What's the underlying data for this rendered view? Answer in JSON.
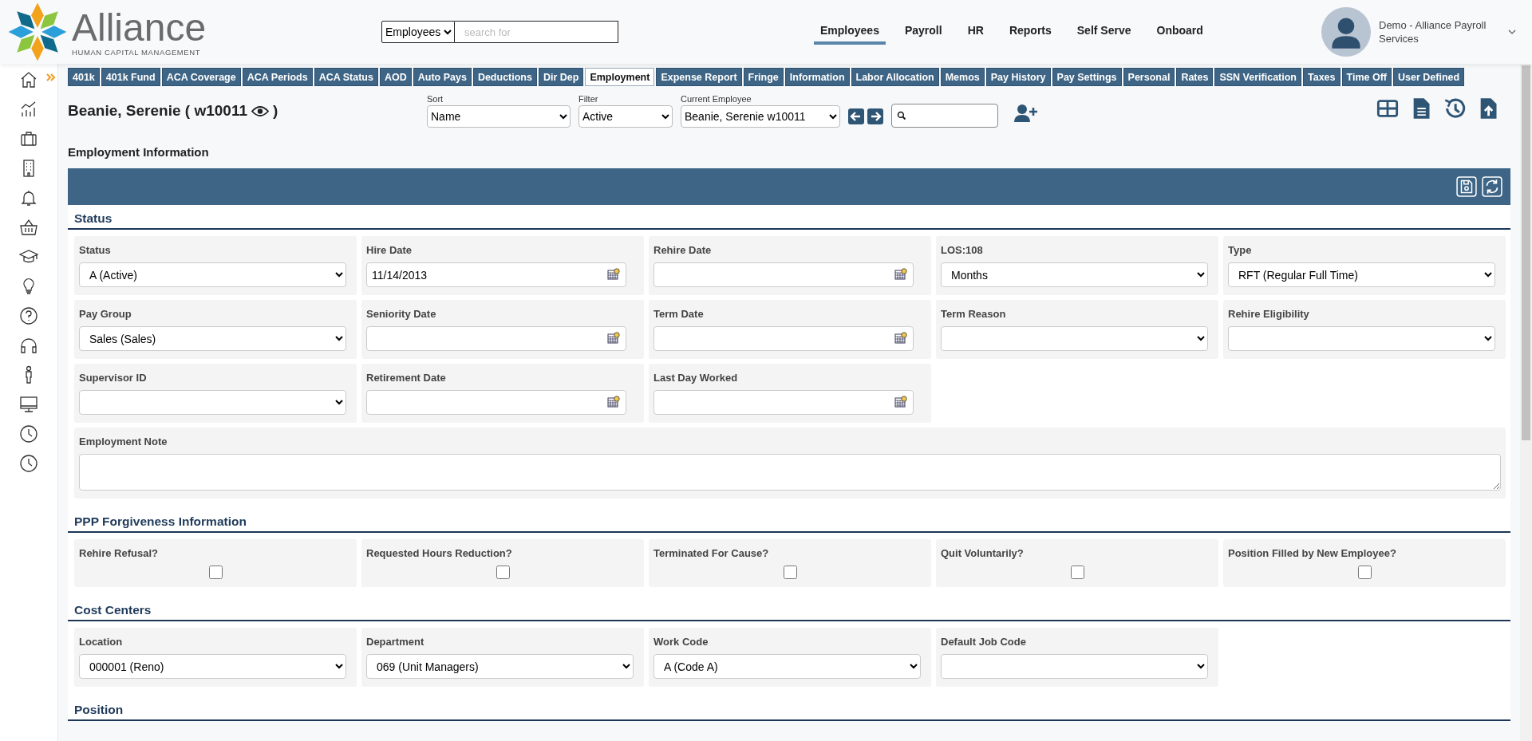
{
  "header": {
    "logo": {
      "name": "Alliance",
      "tagline": "HUMAN CAPITAL MANAGEMENT"
    },
    "search": {
      "scope": "Employees",
      "placeholder": "search for"
    },
    "nav": [
      {
        "label": "Employees",
        "selected": true
      },
      {
        "label": "Payroll",
        "selected": false
      },
      {
        "label": "HR",
        "selected": false
      },
      {
        "label": "Reports",
        "selected": false
      },
      {
        "label": "Self Serve",
        "selected": false
      },
      {
        "label": "Onboard",
        "selected": false
      }
    ],
    "user": {
      "name": "Demo - Alliance Payroll Services"
    }
  },
  "tabs": [
    {
      "label": "401k",
      "selected": false
    },
    {
      "label": "401k Fund",
      "selected": false
    },
    {
      "label": "ACA Coverage",
      "selected": false
    },
    {
      "label": "ACA Periods",
      "selected": false
    },
    {
      "label": "ACA Status",
      "selected": false
    },
    {
      "label": "AOD",
      "selected": false
    },
    {
      "label": "Auto Pays",
      "selected": false
    },
    {
      "label": "Deductions",
      "selected": false
    },
    {
      "label": "Dir Dep",
      "selected": false
    },
    {
      "label": "Employment",
      "selected": true
    },
    {
      "label": "Expense Report",
      "selected": false
    },
    {
      "label": "Fringe",
      "selected": false
    },
    {
      "label": "Information",
      "selected": false
    },
    {
      "label": "Labor Allocation",
      "selected": false
    },
    {
      "label": "Memos",
      "selected": false
    },
    {
      "label": "Pay History",
      "selected": false
    },
    {
      "label": "Pay Settings",
      "selected": false
    },
    {
      "label": "Personal",
      "selected": false
    },
    {
      "label": "Rates",
      "selected": false
    },
    {
      "label": "SSN Verification",
      "selected": false
    },
    {
      "label": "Taxes",
      "selected": false
    },
    {
      "label": "Time Off",
      "selected": false
    },
    {
      "label": "User Defined",
      "selected": false
    }
  ],
  "employee": {
    "name": "Beanie, Serenie ( w10011",
    "suffix": ")"
  },
  "controls": {
    "sort": {
      "label": "Sort",
      "value": "Name"
    },
    "filter": {
      "label": "Filter",
      "value": "Active"
    },
    "current": {
      "label": "Current Employee",
      "value": "Beanie, Serenie w10011"
    }
  },
  "page_title": "Employment Information",
  "sections": [
    {
      "title": "Status",
      "fields": [
        {
          "kind": "select",
          "label": "Status",
          "value": "A (Active)"
        },
        {
          "kind": "date",
          "label": "Hire Date",
          "value": "11/14/2013"
        },
        {
          "kind": "date",
          "label": "Rehire Date"
        },
        {
          "kind": "select",
          "label": "LOS:108",
          "value": "Months"
        },
        {
          "kind": "select",
          "label": "Type",
          "value": "RFT (Regular Full Time)"
        },
        {
          "kind": "select",
          "label": "Pay Group",
          "value": "Sales (Sales)"
        },
        {
          "kind": "date",
          "label": "Seniority Date"
        },
        {
          "kind": "date",
          "label": "Term Date"
        },
        {
          "kind": "select",
          "label": "Term Reason"
        },
        {
          "kind": "select",
          "label": "Rehire Eligibility"
        },
        {
          "kind": "select",
          "label": "Supervisor ID"
        },
        {
          "kind": "date",
          "label": "Retirement Date"
        },
        {
          "kind": "date",
          "label": "Last Day Worked"
        },
        {
          "kind": "textarea",
          "label": "Employment Note"
        }
      ]
    },
    {
      "title": "PPP Forgiveness Information",
      "fields": [
        {
          "kind": "checkbox",
          "label": "Rehire Refusal?",
          "checked": false
        },
        {
          "kind": "checkbox",
          "label": "Requested Hours Reduction?",
          "checked": false
        },
        {
          "kind": "checkbox",
          "label": "Terminated For Cause?",
          "checked": false
        },
        {
          "kind": "checkbox",
          "label": "Quit Voluntarily?",
          "checked": false
        },
        {
          "kind": "checkbox",
          "label": "Position Filled by New Employee?",
          "checked": false
        }
      ]
    },
    {
      "title": "Cost Centers",
      "fields": [
        {
          "kind": "select",
          "label": "Location",
          "value": "000001 (Reno)"
        },
        {
          "kind": "select",
          "label": "Department",
          "value": "069 (Unit Managers)"
        },
        {
          "kind": "select",
          "label": "Work Code",
          "value": "A (Code A)"
        },
        {
          "kind": "select",
          "label": "Default Job Code"
        }
      ]
    },
    {
      "title": "Position"
    }
  ]
}
